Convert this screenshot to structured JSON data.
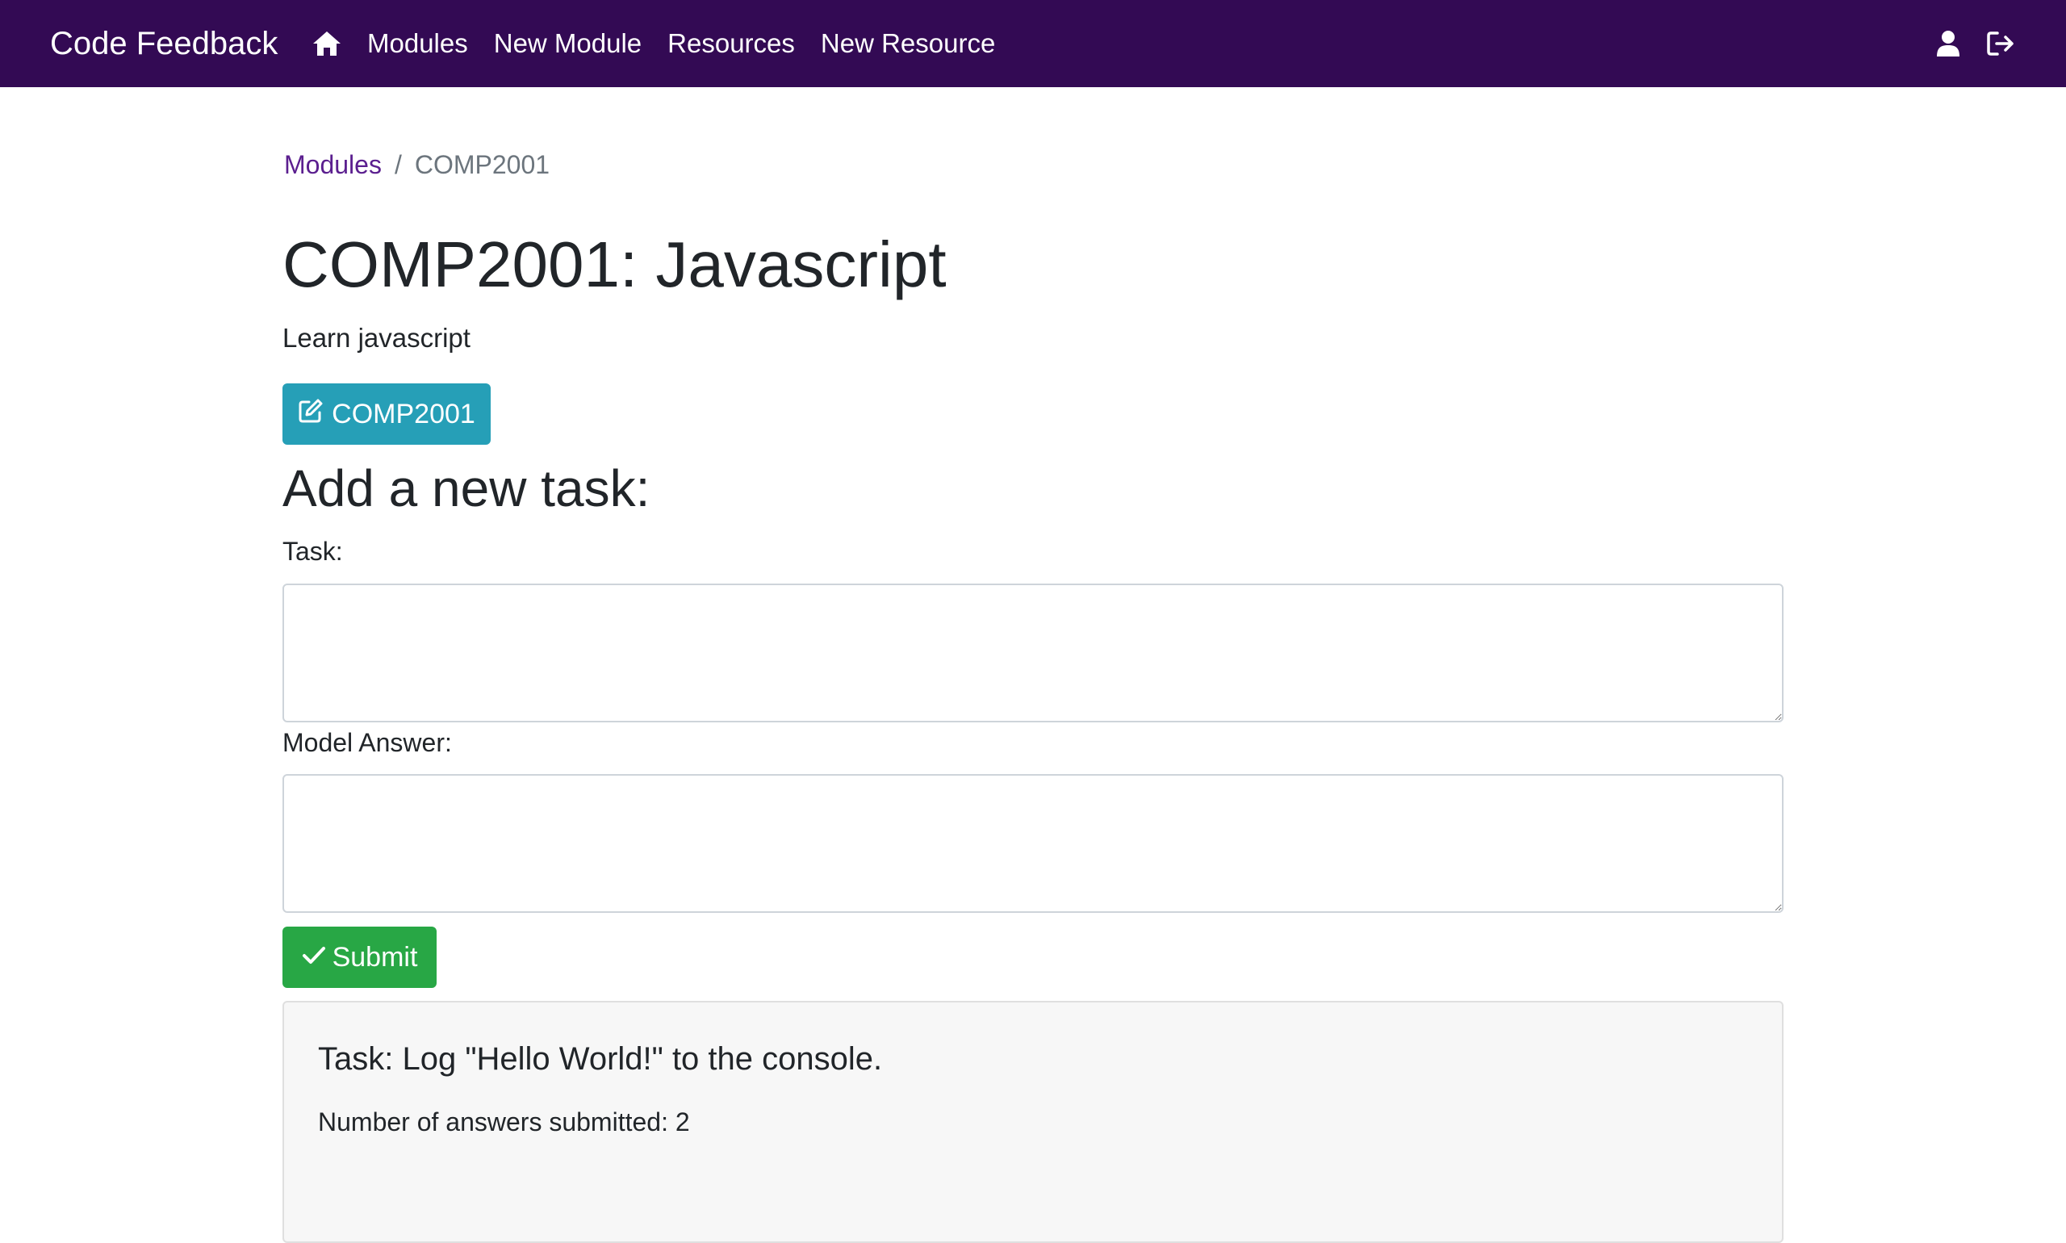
{
  "navbar": {
    "brand": "Code Feedback",
    "links": [
      "Modules",
      "New Module",
      "Resources",
      "New Resource"
    ],
    "icons": [
      "home-icon",
      "user-icon",
      "logout-icon"
    ],
    "background": "#330a54"
  },
  "breadcrumb": {
    "link": "Modules",
    "separator": "/",
    "current": "COMP2001"
  },
  "module": {
    "title": "COMP2001: Javascript",
    "description": "Learn javascript",
    "edit_label": "COMP2001"
  },
  "form": {
    "heading": "Add a new task:",
    "task_label": "Task:",
    "task_value": "",
    "answer_label": "Model Answer:",
    "answer_value": "",
    "submit_label": "Submit"
  },
  "task": {
    "title": "Task: Log \"Hello World!\" to the console.",
    "answers_text": "Number of answers submitted: 2"
  },
  "colors": {
    "edit_button": "#269fb7",
    "submit_button": "#28a745",
    "link": "#5b1f8f"
  }
}
